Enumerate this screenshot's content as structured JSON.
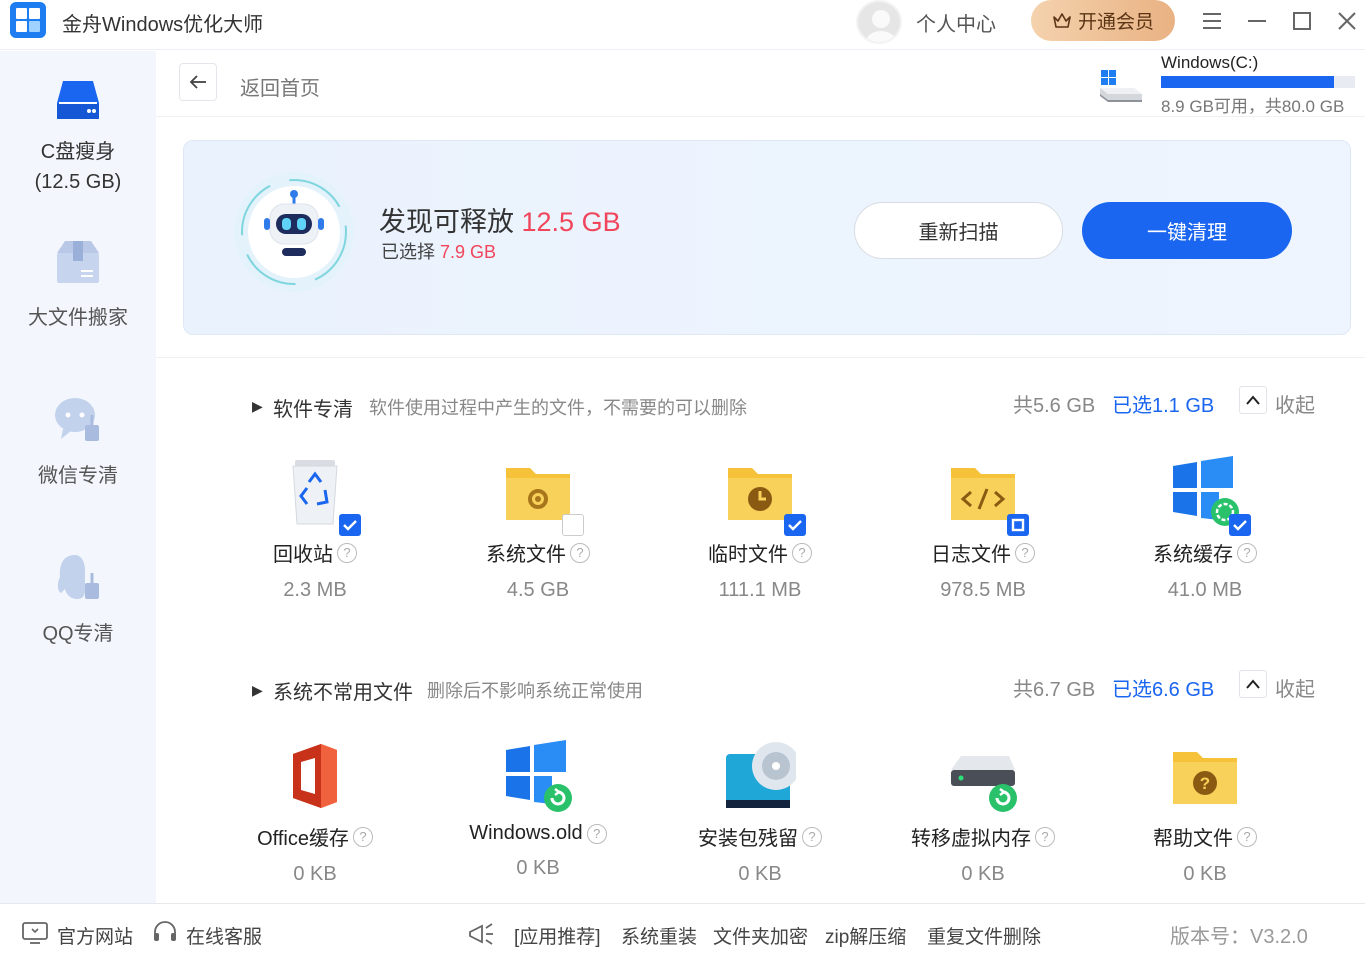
{
  "app": {
    "title": "金舟Windows优化大师"
  },
  "topbar": {
    "user_center": "个人中心",
    "vip": "开通会员",
    "menu_icon": "hamburger-icon"
  },
  "sidebar": {
    "items": [
      {
        "label": "C盘瘦身",
        "sub": "(12.5 GB)",
        "active": true
      },
      {
        "label": "大文件搬家"
      },
      {
        "label": "微信专清"
      },
      {
        "label": "QQ专清"
      }
    ]
  },
  "header": {
    "back_label": "返回首页",
    "drive": {
      "name": "Windows(C:)",
      "free_text": "8.9 GB可用，共80.0 GB",
      "used_fraction": 0.89
    }
  },
  "scan": {
    "found_label": "发现可释放",
    "found_size": "12.5 GB",
    "selected_label": "已选择",
    "selected_size": "7.9 GB",
    "rescan": "重新扫描",
    "clean": "一键清理"
  },
  "sections": [
    {
      "title": "软件专清",
      "desc": "软件使用过程中产生的文件，不需要的可以删除",
      "total": "共5.6 GB",
      "selected": "已选1.1 GB",
      "collapse": "收起",
      "items": [
        {
          "name": "回收站",
          "size": "2.3 MB",
          "check": "on",
          "icon": "recycle-bin-icon"
        },
        {
          "name": "系统文件",
          "size": "4.5 GB",
          "check": "off",
          "icon": "system-files-folder-icon"
        },
        {
          "name": "临时文件",
          "size": "111.1 MB",
          "check": "on",
          "icon": "temp-files-folder-icon"
        },
        {
          "name": "日志文件",
          "size": "978.5 MB",
          "check": "partial",
          "icon": "log-files-folder-icon"
        },
        {
          "name": "系统缓存",
          "size": "41.0 MB",
          "check": "on",
          "icon": "system-cache-icon"
        }
      ]
    },
    {
      "title": "系统不常用文件",
      "desc": "删除后不影响系统正常使用",
      "total": "共6.7 GB",
      "selected": "已选6.6 GB",
      "collapse": "收起",
      "items": [
        {
          "name": "Office缓存",
          "size": "0 KB",
          "icon": "office-icon"
        },
        {
          "name": "Windows.old",
          "size": "0 KB",
          "icon": "windows-old-icon"
        },
        {
          "name": "安装包残留",
          "size": "0 KB",
          "icon": "installer-disc-icon"
        },
        {
          "name": "转移虚拟内存",
          "size": "0 KB",
          "icon": "virtual-memory-drive-icon"
        },
        {
          "name": "帮助文件",
          "size": "0 KB",
          "icon": "help-files-folder-icon"
        }
      ]
    }
  ],
  "footer": {
    "website": "官方网站",
    "support": "在线客服",
    "recommend": "[应用推荐]",
    "links": [
      "系统重装",
      "文件夹加密",
      "zip解压缩",
      "重复文件删除"
    ],
    "version": "版本号：V3.2.0"
  },
  "colors": {
    "accent": "#1a66f0",
    "highlight": "#f0455a",
    "sidebar_bg": "#f3f7fd"
  }
}
